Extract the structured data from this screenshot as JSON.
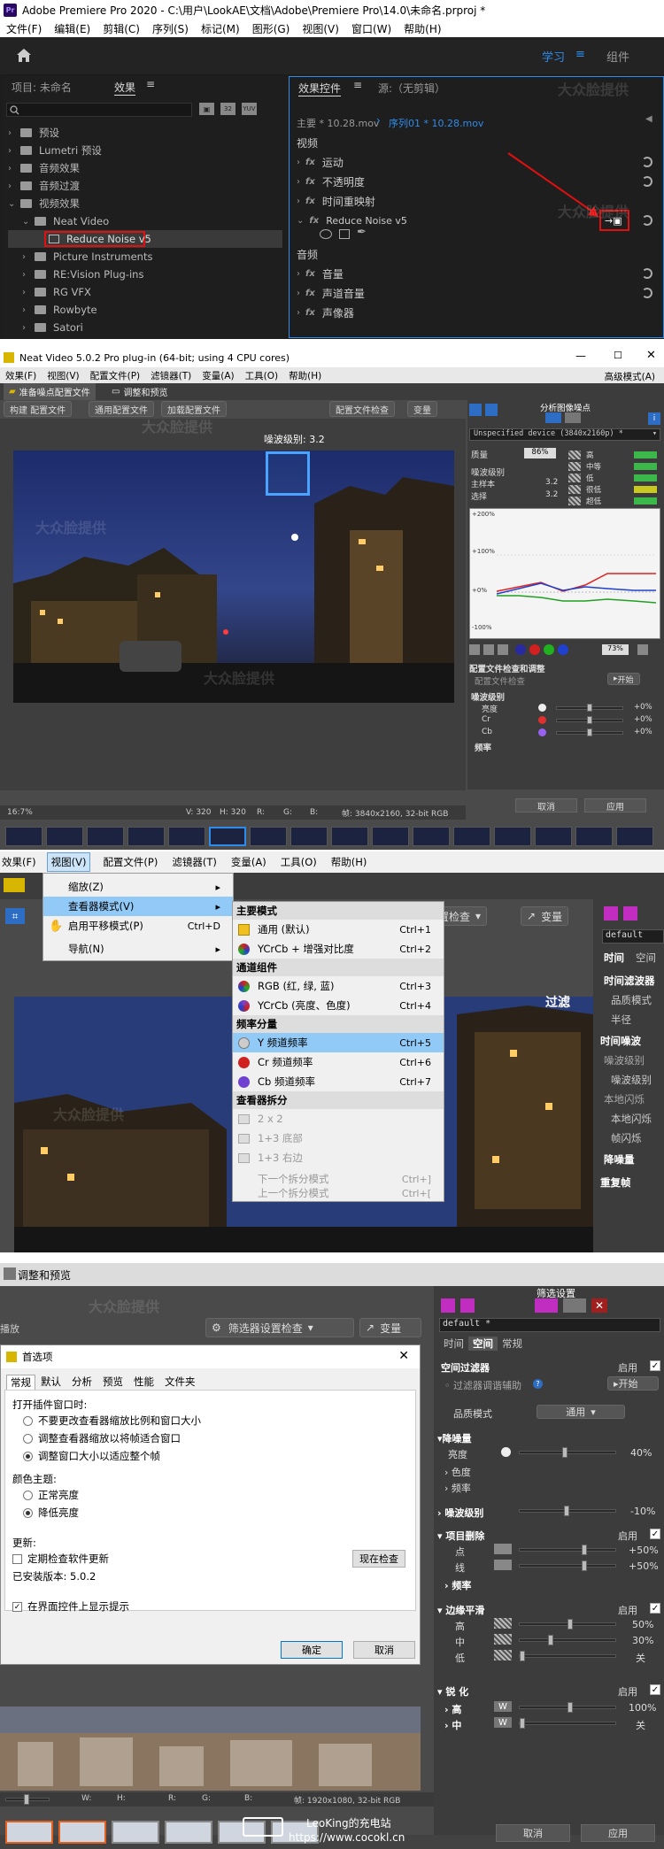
{
  "s1": {
    "title": "Adobe Premiere Pro 2020 - C:\\用户\\LookAE\\文档\\Adobe\\Premiere Pro\\14.0\\未命名.prproj *",
    "menu": [
      "文件(F)",
      "编辑(E)",
      "剪辑(C)",
      "序列(S)",
      "标记(M)",
      "图形(G)",
      "视图(V)",
      "窗口(W)",
      "帮助(H)"
    ],
    "workspace": [
      "学习",
      "组件"
    ],
    "left_tabs": [
      "项目: 未命名",
      "效果"
    ],
    "tree": [
      "预设",
      "Lumetri 预设",
      "音频效果",
      "音频过渡",
      "视频效果",
      "Neat Video",
      "Reduce Noise v5",
      "Picture Instruments",
      "RE:Vision Plug-ins",
      "RG VFX",
      "Rowbyte",
      "Satori"
    ],
    "right_tabs": [
      "效果控件",
      "源:（无剪辑）"
    ],
    "master": "主要 * 10.28.mov",
    "seq": "序列01 * 10.28.mov",
    "video_label": "视频",
    "video_fx": [
      "运动",
      "不透明度",
      "时间重映射",
      "Reduce Noise v5"
    ],
    "audio_label": "音频",
    "audio_fx": [
      "音量",
      "声道音量",
      "声像器"
    ],
    "watermark": "大众脸提供"
  },
  "s2": {
    "title": "Neat Video 5.0.2 Pro plug-in (64-bit; using 4 CPU cores)",
    "menu": [
      "效果(F)",
      "视图(V)",
      "配置文件(P)",
      "滤镜器(T)",
      "变量(A)",
      "工具(O)",
      "帮助(H)"
    ],
    "advanced": "高级模式(A)",
    "tabs": [
      "准备噪点配置文件",
      "调整和预览"
    ],
    "btns": [
      "构建 配置文件",
      "通用配置文件",
      "加载配置文件",
      "配置文件检查",
      "变量"
    ],
    "noise_level": "噪波级别: 3.2",
    "analyze": "分析图像噪点",
    "device": "Unspecified device (3840x2160p) *",
    "quality": "质量",
    "quality_val": "86%",
    "noise_title": "噪波级别",
    "main_label": "主样本",
    "sel_label": "选择",
    "main_val": "3.2",
    "sel_val": "3.2",
    "freq": [
      "高",
      "中等",
      "低",
      "很低",
      "超低"
    ],
    "graph": [
      "+200%",
      "+100%",
      "+0%",
      "-100%"
    ],
    "pct": "73%",
    "profile_title": "配置文件检查和调整",
    "profile_helper": "配置文件检查",
    "start": "开始",
    "nl_title": "噪波级别",
    "channels": [
      "亮度",
      "Cr",
      "Cb"
    ],
    "channel_vals": [
      "+0%",
      "+0%",
      "+0%"
    ],
    "freq_title": "频率",
    "zoom": "16:7%",
    "status": [
      "V: 320",
      "H: 320",
      "R:",
      "G:",
      "B:",
      "帧: 3840x2160, 32-bit RGB"
    ],
    "cancel": "取消",
    "apply": "应用",
    "watermark": "大众脸提供"
  },
  "s3": {
    "menubar": [
      "效果(F)",
      "视图(V)",
      "配置文件(P)",
      "滤镜器(T)",
      "变量(A)",
      "工具(O)",
      "帮助(H)"
    ],
    "view_menu": [
      {
        "label": "缩放(Z)",
        "sc": "",
        "arrow": true
      },
      {
        "label": "查看器模式(V)",
        "sc": "",
        "arrow": true
      },
      {
        "label": "启用平移模式(P)",
        "sc": "Ctrl+D",
        "arrow": false
      },
      {
        "label": "导航(N)",
        "sc": "",
        "arrow": true
      }
    ],
    "sub_h": [
      "主要模式",
      "通道组件",
      "频率分量",
      "查看器拆分"
    ],
    "sub": [
      {
        "label": "通用 (默认)",
        "sc": "Ctrl+1"
      },
      {
        "label": "YCrCb + 增强对比度",
        "sc": "Ctrl+2"
      },
      {
        "label": "RGB (红, 绿, 蓝)",
        "sc": "Ctrl+3"
      },
      {
        "label": "YCrCb (亮度、色度)",
        "sc": "Ctrl+4"
      },
      {
        "label": "Y 频道频率",
        "sc": "Ctrl+5"
      },
      {
        "label": "Cr 频道频率",
        "sc": "Ctrl+6"
      },
      {
        "label": "Cb 频道频率",
        "sc": "Ctrl+7"
      },
      {
        "label": "2 x 2",
        "sc": ""
      },
      {
        "label": "1+3 底部",
        "sc": ""
      },
      {
        "label": "1+3 右边",
        "sc": ""
      },
      {
        "label": "下一个拆分模式",
        "sc": "Ctrl+]"
      },
      {
        "label": "上一个拆分模式",
        "sc": "Ctrl+["
      }
    ],
    "bg_btns": [
      "置检查",
      "变量"
    ],
    "filter": "过滤",
    "right": [
      "default",
      "时间",
      "空间",
      "时间滤波器",
      "品质模式",
      "半径",
      "时间噪波",
      "噪波级别",
      "噪波级别",
      "本地闪烁",
      "本地闪烁",
      "帧闪烁",
      "降噪量",
      "重复帧"
    ]
  },
  "s4": {
    "tab": "调整和预览",
    "btns": [
      "筛选器设置检查",
      "变量"
    ],
    "filter_title": "筛选设置",
    "filter": "过滤",
    "dlg_title": "首选项",
    "dlg_tabs": [
      "常规",
      "默认",
      "分析",
      "预览",
      "性能",
      "文件夹"
    ],
    "open_label": "打开插件窗口时:",
    "open_opts": [
      "不要更改查看器缩放比例和窗口大小",
      "调整查看器缩放以将帧适合窗口",
      "调整窗口大小以适应整个帧"
    ],
    "theme_label": "颜色主题:",
    "theme_opts": [
      "正常亮度",
      "降低亮度"
    ],
    "update_label": "更新:",
    "update_chk": "定期检查软件更新",
    "check_now": "现在检查",
    "installed": "已安装版本: 5.0.2",
    "tips": "在界面控件上显示提示",
    "ok": "确定",
    "cancel": "取消",
    "rp": {
      "default": "default *",
      "tabs": [
        "时间",
        "空间",
        "常规"
      ],
      "spatial": "空间过滤器",
      "enable": "启用",
      "assist": "过滤器调谐辅助",
      "start": "开始",
      "quality": "品质模式",
      "quality_val": "通用",
      "nr": "降噪量",
      "lum": "亮度",
      "lum_val": "40%",
      "chroma": "色度",
      "freq": "频率",
      "nl": "噪波级别",
      "nl_val": "-10%",
      "artifact": "项目删除",
      "dot": "点",
      "line": "线",
      "dot_val": "+50%",
      "line_val": "+50%",
      "freq2": "频率",
      "edge": "边缘平滑",
      "hi": "高",
      "mid": "中",
      "lo": "低",
      "hi_val": "50%",
      "mid_val": "30%",
      "lo_val": "关",
      "sharp": "锐  化",
      "s_hi": "高",
      "s_mid": "中",
      "s_hi_val": "100%",
      "s_mid_val": "关"
    },
    "status": [
      "W:",
      "H:",
      "R:",
      "G:",
      "B:",
      "帧: 1920x1080, 32-bit RGB"
    ],
    "footer": [
      "LeoKing的充电站",
      "https://www.cocokl.cn"
    ],
    "cancel2": "取消",
    "apply": "应用",
    "watermark": "大众脸提供"
  }
}
